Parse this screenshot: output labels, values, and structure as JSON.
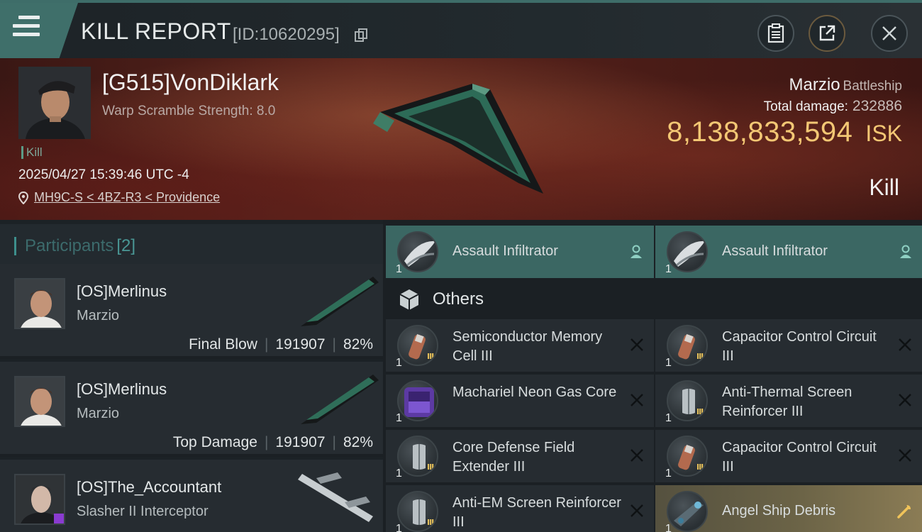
{
  "header": {
    "title": "KILL REPORT",
    "id_text": "[ID:10620295]"
  },
  "victim": {
    "name": "[G515]VonDiklark",
    "scramble": "Warp Scramble Strength: 8.0",
    "tag": "Kill",
    "datetime": "2025/04/27 15:39:46 UTC -4",
    "location": "MH9C-S < 4BZ-R3 < Providence",
    "ship_name": "Marzio",
    "ship_class": "Battleship",
    "total_damage_label": "Total damage:",
    "total_damage": "232886",
    "isk_value": "8,138,833,594",
    "isk_unit": "ISK",
    "result": "Kill"
  },
  "participants": {
    "label": "Participants",
    "count": "[2]",
    "rows": [
      {
        "name": "[OS]Merlinus",
        "ship": "Marzio",
        "role": "Final Blow",
        "damage": "191907",
        "percent": "82%"
      },
      {
        "name": "[OS]Merlinus",
        "ship": "Marzio",
        "role": "Top Damage",
        "damage": "191907",
        "percent": "82%"
      },
      {
        "name": "[OS]The_Accountant",
        "ship": "Slasher II Interceptor"
      }
    ]
  },
  "items": {
    "pilots": [
      {
        "qty": "1",
        "name": "Assault Infiltrator"
      },
      {
        "qty": "1",
        "name": "Assault Infiltrator"
      }
    ],
    "others_label": "Others",
    "left": [
      {
        "qty": "1",
        "name": "Semiconductor Memory Cell III"
      },
      {
        "qty": "1",
        "name": "Machariel Neon Gas Core"
      },
      {
        "qty": "1",
        "name": "Core Defense Field Extender III"
      },
      {
        "qty": "1",
        "name": "Anti-EM Screen Reinforcer III"
      }
    ],
    "right": [
      {
        "qty": "1",
        "name": "Capacitor Control Circuit III"
      },
      {
        "qty": "1",
        "name": "Anti-Thermal Screen Reinforcer III"
      },
      {
        "qty": "1",
        "name": "Capacitor Control Circuit III"
      },
      {
        "qty": "1",
        "name": "Angel Ship Debris"
      }
    ]
  },
  "colors": {
    "accent": "#3f6f6a",
    "isk": "#f3c774",
    "gold_item": "#8b7c55"
  }
}
